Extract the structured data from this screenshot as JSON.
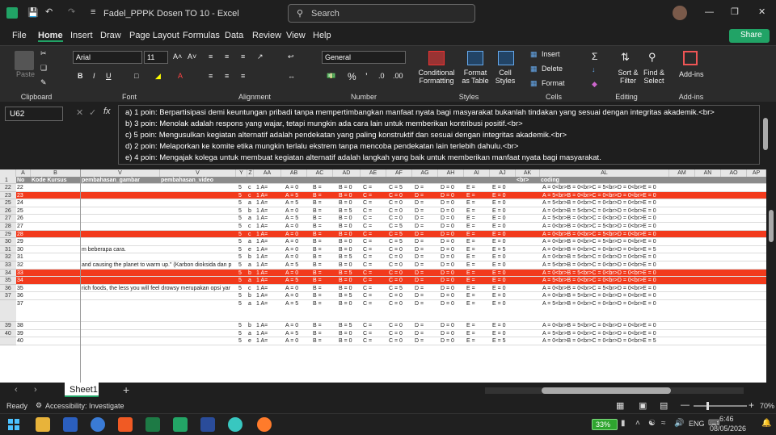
{
  "titlebar": {
    "doc_title": "Fadel_PPPK Dosen TO 10  -  Excel",
    "search_placeholder": "Search"
  },
  "menu": [
    "File",
    "Home",
    "Insert",
    "Draw",
    "Page Layout",
    "Formulas",
    "Data",
    "Review",
    "View",
    "Help"
  ],
  "share_label": "Share",
  "ribbon": {
    "clipboard": "Clipboard",
    "paste": "Paste",
    "font_name": "Arial",
    "font_size": "11",
    "font": "Font",
    "alignment": "Alignment",
    "number_format": "General",
    "number": "Number",
    "styles": "Styles",
    "cond_fmt": "Conditional Formatting",
    "fmt_table": "Format as Table",
    "cell_styles": "Cell Styles",
    "cells": "Cells",
    "insert": "Insert",
    "delete": "Delete",
    "format": "Format",
    "editing": "Editing",
    "sort": "Sort & Filter",
    "find": "Find & Select",
    "addins": "Add-ins",
    "addins_group": "Add-ins"
  },
  "namebox": "U62",
  "formula_lines": [
    "a) 1 poin: Berpartisipasi demi keuntungan pribadi tanpa mempertimbangkan manfaat nyata bagi masyarakat bukanlah tindakan yang sesuai dengan integritas akademik.<br>",
    "b) 3 poin: Menolak adalah respons yang wajar, tetapi mungkin ada cara lain untuk memberikan kontribusi positif.<br>",
    "c) 5 poin: Mengusulkan kegiatan alternatif adalah pendekatan yang paling konstruktif dan sesuai dengan integritas akademik.<br>",
    "d) 2 poin: Melaporkan ke komite etika mungkin terlalu ekstrem tanpa mencoba pendekatan lain terlebih dahulu.<br>",
    "e) 4 poin: Mengajak kolega untuk membuat kegiatan alternatif adalah langkah yang baik untuk memberikan manfaat nyata bagi masyarakat."
  ],
  "columns": [
    "A",
    "B",
    "V",
    "V",
    "Y",
    "Z",
    "AA",
    "AB",
    "AC",
    "AD",
    "AE",
    "AF",
    "AG",
    "AH",
    "AI",
    "AJ",
    "AK",
    "AL",
    "AM",
    "AN",
    "AO",
    "AP"
  ],
  "header_row": {
    "no": "No",
    "kode": "Kode Kursus",
    "pg": "pembahasan_gambar",
    "pv": "pembahasan_video",
    "br": "<br>",
    "coding": "coding"
  },
  "rows": [
    {
      "r": "22",
      "n": "22",
      "red": false,
      "y": "5",
      "z": "c",
      "aa": "1 A=",
      "ab": "A = 0",
      "ac": "B =",
      "ad": "B = 0",
      "ae": "C =",
      "af": "C = 5",
      "ag": "D =",
      "ah": "D = 0",
      "ai": "E =",
      "aj": "E = 0",
      "al": "A = 0<br>B = 0<br>C = 5<br>D = 0<br>E = 0"
    },
    {
      "r": "23",
      "n": "23",
      "red": true,
      "y": "5",
      "z": "c",
      "aa": "1 A=",
      "ab": "A = 5",
      "ac": "B =",
      "ad": "B = 0",
      "ae": "C =",
      "af": "C = 0",
      "ag": "D =",
      "ah": "D = 0",
      "ai": "E =",
      "aj": "E = 0",
      "al": "A = 5<br>B = 0<br>C = 0<br>D = 0<br>E = 0"
    },
    {
      "r": "25",
      "n": "24",
      "red": false,
      "y": "5",
      "z": "a",
      "aa": "1 A=",
      "ab": "A = 5",
      "ac": "B =",
      "ad": "B = 0",
      "ae": "C =",
      "af": "C = 0",
      "ag": "D =",
      "ah": "D = 0",
      "ai": "E =",
      "aj": "E = 0",
      "al": "A = 5<br>B = 0<br>C = 0<br>D = 0<br>E = 0"
    },
    {
      "r": "26",
      "n": "25",
      "red": false,
      "y": "5",
      "z": "b",
      "aa": "1 A=",
      "ab": "A = 0",
      "ac": "B =",
      "ad": "B = 5",
      "ae": "C =",
      "af": "C = 0",
      "ag": "D =",
      "ah": "D = 0",
      "ai": "E =",
      "aj": "E = 0",
      "al": "A = 0<br>B = 5<br>C = 0<br>D = 0<br>E = 0"
    },
    {
      "r": "27",
      "n": "26",
      "red": false,
      "y": "5",
      "z": "a",
      "aa": "1 A=",
      "ab": "A = 5",
      "ac": "B =",
      "ad": "B = 0",
      "ae": "C =",
      "af": "C = 0",
      "ag": "D =",
      "ah": "D = 0",
      "ai": "E =",
      "aj": "E = 0",
      "al": "A = 5<br>B = 0<br>C = 0<br>D = 0<br>E = 0"
    },
    {
      "r": "28",
      "n": "27",
      "red": false,
      "y": "5",
      "z": "c",
      "aa": "1 A=",
      "ab": "A = 0",
      "ac": "B =",
      "ad": "B = 0",
      "ae": "C =",
      "af": "C = 5",
      "ag": "D =",
      "ah": "D = 0",
      "ai": "E =",
      "aj": "E = 0",
      "al": "A = 0<br>B = 0<br>C = 5<br>D = 0<br>E = 0"
    },
    {
      "r": "29",
      "n": "28",
      "red": true,
      "y": "5",
      "z": "c",
      "aa": "1 A=",
      "ab": "A = 0",
      "ac": "B =",
      "ad": "B = 0",
      "ae": "C =",
      "af": "C = 5",
      "ag": "D =",
      "ah": "D = 0",
      "ai": "E =",
      "aj": "E = 0",
      "al": "A = 0<br>B = 0<br>C = 5<br>D = 0<br>E = 0"
    },
    {
      "r": "30",
      "n": "29",
      "red": false,
      "y": "5",
      "z": "a",
      "aa": "1 A=",
      "ab": "A = 0",
      "ac": "B =",
      "ad": "B = 0",
      "ae": "C =",
      "af": "C = 5",
      "ag": "D =",
      "ah": "D = 0",
      "ai": "E =",
      "aj": "E = 0",
      "al": "A = 0<br>B = 0<br>C = 5<br>D = 0<br>E = 0"
    },
    {
      "r": "31",
      "n": "30",
      "red": false,
      "b": "m beberapa cara.",
      "y": "5",
      "z": "e",
      "aa": "1 A=",
      "ab": "A = 0",
      "ac": "B =",
      "ad": "B = 0",
      "ae": "C =",
      "af": "C = 0",
      "ag": "D =",
      "ah": "D = 0",
      "ai": "E =",
      "aj": "E = 5",
      "al": "A = 0<br>B = 0<br>C = 0<br>D = 0<br>E = 5"
    },
    {
      "r": "32",
      "n": "31",
      "red": false,
      "y": "5",
      "z": "b",
      "aa": "1 A=",
      "ab": "A = 0",
      "ac": "B =",
      "ad": "B = 5",
      "ae": "C =",
      "af": "C = 0",
      "ag": "D =",
      "ah": "D = 0",
      "ai": "E =",
      "aj": "E = 0",
      "al": "A = 0<br>B = 5<br>C = 0<br>D = 0<br>E = 0"
    },
    {
      "r": "33",
      "n": "32",
      "red": false,
      "b": "and causing the planet to warm up.\" (Karbon dioksida dan p",
      "y": "5",
      "z": "a",
      "aa": "1 A=",
      "ab": "A = 5",
      "ac": "B =",
      "ad": "B = 0",
      "ae": "C =",
      "af": "C = 0",
      "ag": "D =",
      "ah": "D = 0",
      "ai": "E =",
      "aj": "E = 0",
      "al": "A = 5<br>B = 0<br>C = 0<br>D = 0<br>E = 0"
    },
    {
      "r": "34",
      "n": "33",
      "red": true,
      "y": "5",
      "z": "b",
      "aa": "1 A=",
      "ab": "A = 0",
      "ac": "B =",
      "ad": "B = 5",
      "ae": "C =",
      "af": "C = 0",
      "ag": "D =",
      "ah": "D = 0",
      "ai": "E =",
      "aj": "E = 0",
      "al": "A = 0<br>B = 5<br>C = 0<br>D = 0<br>E = 0"
    },
    {
      "r": "35",
      "n": "34",
      "red": true,
      "y": "5",
      "z": "a",
      "aa": "1 A=",
      "ab": "A = 5",
      "ac": "B =",
      "ad": "B = 0",
      "ae": "C =",
      "af": "C = 0",
      "ag": "D =",
      "ah": "D = 0",
      "ai": "E =",
      "aj": "E = 0",
      "al": "A = 5<br>B = 0<br>C = 0<br>D = 0<br>E = 0"
    },
    {
      "r": "36",
      "n": "35",
      "red": false,
      "b": "rich foods, the less you will feel drowsy merupakan opsi yar",
      "y": "5",
      "z": "c",
      "aa": "1 A=",
      "ab": "A = 0",
      "ac": "B =",
      "ad": "B = 0",
      "ae": "C =",
      "af": "C = 5",
      "ag": "D =",
      "ah": "D = 0",
      "ai": "E =",
      "aj": "E = 0",
      "al": "A = 0<br>B = 0<br>C = 5<br>D = 0<br>E = 0"
    },
    {
      "r": "37",
      "n": "36",
      "red": false,
      "y": "5",
      "z": "b",
      "aa": "1 A=",
      "ab": "A = 0",
      "ac": "B =",
      "ad": "B = 5",
      "ae": "C =",
      "af": "C = 0",
      "ag": "D =",
      "ah": "D = 0",
      "ai": "E =",
      "aj": "E = 0",
      "al": "A = 0<br>B = 5<br>C = 0<br>D = 0<br>E = 0"
    },
    {
      "r": "",
      "n": "37",
      "red": false,
      "y": "5",
      "z": "a",
      "aa": "1 A=",
      "ab": "A = 5",
      "ac": "B =",
      "ad": "B = 0",
      "ae": "C =",
      "af": "C = 0",
      "ag": "D =",
      "ah": "D = 0",
      "ai": "E =",
      "aj": "E = 0",
      "al": "A = 5<br>B = 0<br>C = 0<br>D = 0<br>E = 0",
      "tall": true
    },
    {
      "r": "39",
      "n": "38",
      "red": false,
      "y": "5",
      "z": "b",
      "aa": "1 A=",
      "ab": "A = 0",
      "ac": "B =",
      "ad": "B = 5",
      "ae": "C =",
      "af": "C = 0",
      "ag": "D =",
      "ah": "D = 0",
      "ai": "E =",
      "aj": "E = 0",
      "al": "A = 0<br>B = 5<br>C = 0<br>D = 0<br>E = 0"
    },
    {
      "r": "40",
      "n": "39",
      "red": false,
      "y": "5",
      "z": "a",
      "aa": "1 A=",
      "ab": "A = 5",
      "ac": "B =",
      "ad": "B = 0",
      "ae": "C =",
      "af": "C = 0",
      "ag": "D =",
      "ah": "D = 0",
      "ai": "E =",
      "aj": "E = 0",
      "al": "A = 5<br>B = 0<br>C = 0<br>D = 0<br>E = 0"
    },
    {
      "r": "",
      "n": "40",
      "red": false,
      "y": "5",
      "z": "e",
      "aa": "1 A=",
      "ab": "A = 0",
      "ac": "B =",
      "ad": "B = 0",
      "ae": "C =",
      "af": "C = 0",
      "ag": "D =",
      "ah": "D = 0",
      "ai": "E =",
      "aj": "E = 5",
      "al": "A = 0<br>B = 0<br>C = 0<br>D = 0<br>E = 5"
    }
  ],
  "sheet_tab": "Sheet1",
  "status": {
    "ready": "Ready",
    "accessibility": "Accessibility: Investigate",
    "zoom": "70%"
  },
  "taskbar": {
    "battery": "33%",
    "lang": "ENG",
    "time": "6:46",
    "date": "08/05/2026"
  },
  "colors": {
    "accent": "#21a366",
    "highlight_red": "#f23a1c"
  }
}
